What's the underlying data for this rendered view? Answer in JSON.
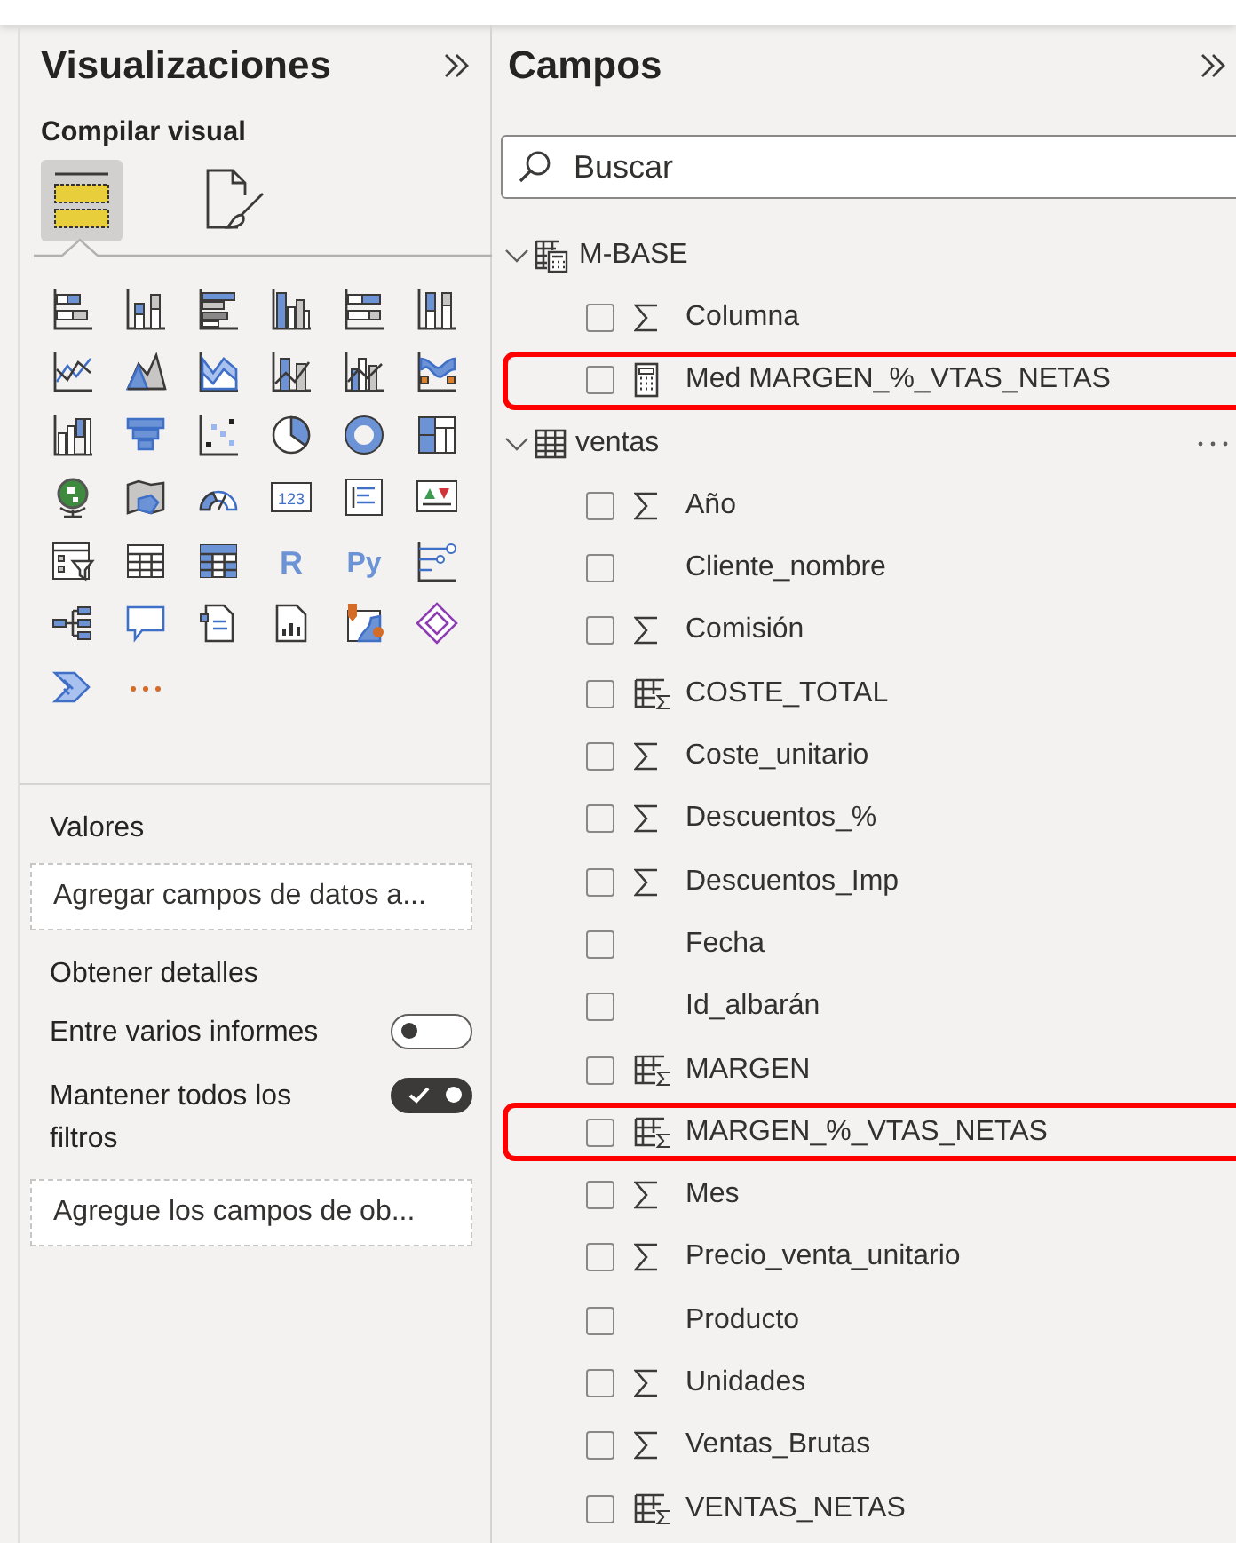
{
  "visualizations": {
    "title": "Visualizaciones",
    "subtitle": "Compilar visual",
    "tabs": [
      {
        "kind": "build",
        "selected": true
      },
      {
        "kind": "format",
        "selected": false
      }
    ],
    "gallery": [
      {
        "kind": "stacked-bar"
      },
      {
        "kind": "stacked-column"
      },
      {
        "kind": "clustered-bar"
      },
      {
        "kind": "clustered-column"
      },
      {
        "kind": "percent-bar"
      },
      {
        "kind": "percent-column"
      },
      {
        "kind": "line"
      },
      {
        "kind": "area"
      },
      {
        "kind": "stacked-area"
      },
      {
        "kind": "line-column"
      },
      {
        "kind": "line-clustered"
      },
      {
        "kind": "ribbon"
      },
      {
        "kind": "waterfall"
      },
      {
        "kind": "funnel"
      },
      {
        "kind": "scatter"
      },
      {
        "kind": "pie"
      },
      {
        "kind": "donut"
      },
      {
        "kind": "treemap"
      },
      {
        "kind": "globe"
      },
      {
        "kind": "filled-map"
      },
      {
        "kind": "gauge"
      },
      {
        "kind": "card",
        "label": "123"
      },
      {
        "kind": "multirow-card"
      },
      {
        "kind": "kpi"
      },
      {
        "kind": "slicer"
      },
      {
        "kind": "table"
      },
      {
        "kind": "matrix"
      },
      {
        "kind": "r-visual",
        "label": "R"
      },
      {
        "kind": "python-visual",
        "label": "Py"
      },
      {
        "kind": "influencers"
      },
      {
        "kind": "decomposition"
      },
      {
        "kind": "qa"
      },
      {
        "kind": "narrative"
      },
      {
        "kind": "paginated"
      },
      {
        "kind": "arcgis"
      },
      {
        "kind": "power-apps"
      },
      {
        "kind": "power-automate"
      },
      {
        "kind": "more"
      }
    ],
    "values": {
      "label": "Valores",
      "placeholder": "Agregar campos de datos a..."
    },
    "drillthrough": {
      "label": "Obtener detalles",
      "toggles": [
        {
          "label": "Entre varios informes",
          "on": false
        },
        {
          "label": "Mantener todos los filtros",
          "on": true
        }
      ],
      "placeholder": "Agregue los campos de ob..."
    }
  },
  "fields": {
    "title": "Campos",
    "search": {
      "placeholder": "Buscar"
    },
    "tables": [
      {
        "name": "M-BASE",
        "kind": "calc-table",
        "expanded": true,
        "show_more": false,
        "fields": [
          {
            "name": "Columna",
            "kind": "sum",
            "checked": false,
            "highlighted": false
          },
          {
            "name": "Med MARGEN_%_VTAS_NETAS",
            "kind": "measure",
            "checked": false,
            "highlighted": true
          }
        ]
      },
      {
        "name": "ventas",
        "kind": "table",
        "expanded": true,
        "show_more": true,
        "fields": [
          {
            "name": "Año",
            "kind": "sum",
            "checked": false,
            "highlighted": false
          },
          {
            "name": "Cliente_nombre",
            "kind": "text",
            "checked": false,
            "highlighted": false
          },
          {
            "name": "Comisión",
            "kind": "sum",
            "checked": false,
            "highlighted": false
          },
          {
            "name": "COSTE_TOTAL",
            "kind": "calc-column",
            "checked": false,
            "highlighted": false
          },
          {
            "name": "Coste_unitario",
            "kind": "sum",
            "checked": false,
            "highlighted": false
          },
          {
            "name": "Descuentos_%",
            "kind": "sum",
            "checked": false,
            "highlighted": false
          },
          {
            "name": "Descuentos_Imp",
            "kind": "sum",
            "checked": false,
            "highlighted": false
          },
          {
            "name": "Fecha",
            "kind": "text",
            "checked": false,
            "highlighted": false
          },
          {
            "name": "Id_albarán",
            "kind": "text",
            "checked": false,
            "highlighted": false
          },
          {
            "name": "MARGEN",
            "kind": "calc-column",
            "checked": false,
            "highlighted": false
          },
          {
            "name": "MARGEN_%_VTAS_NETAS",
            "kind": "calc-column",
            "checked": false,
            "highlighted": true
          },
          {
            "name": "Mes",
            "kind": "sum",
            "checked": false,
            "highlighted": false
          },
          {
            "name": "Precio_venta_unitario",
            "kind": "sum",
            "checked": false,
            "highlighted": false
          },
          {
            "name": "Producto",
            "kind": "text",
            "checked": false,
            "highlighted": false
          },
          {
            "name": "Unidades",
            "kind": "sum",
            "checked": false,
            "highlighted": false
          },
          {
            "name": "Ventas_Brutas",
            "kind": "sum",
            "checked": false,
            "highlighted": false
          },
          {
            "name": "VENTAS_NETAS",
            "kind": "calc-column",
            "checked": false,
            "highlighted": false
          }
        ]
      }
    ]
  }
}
